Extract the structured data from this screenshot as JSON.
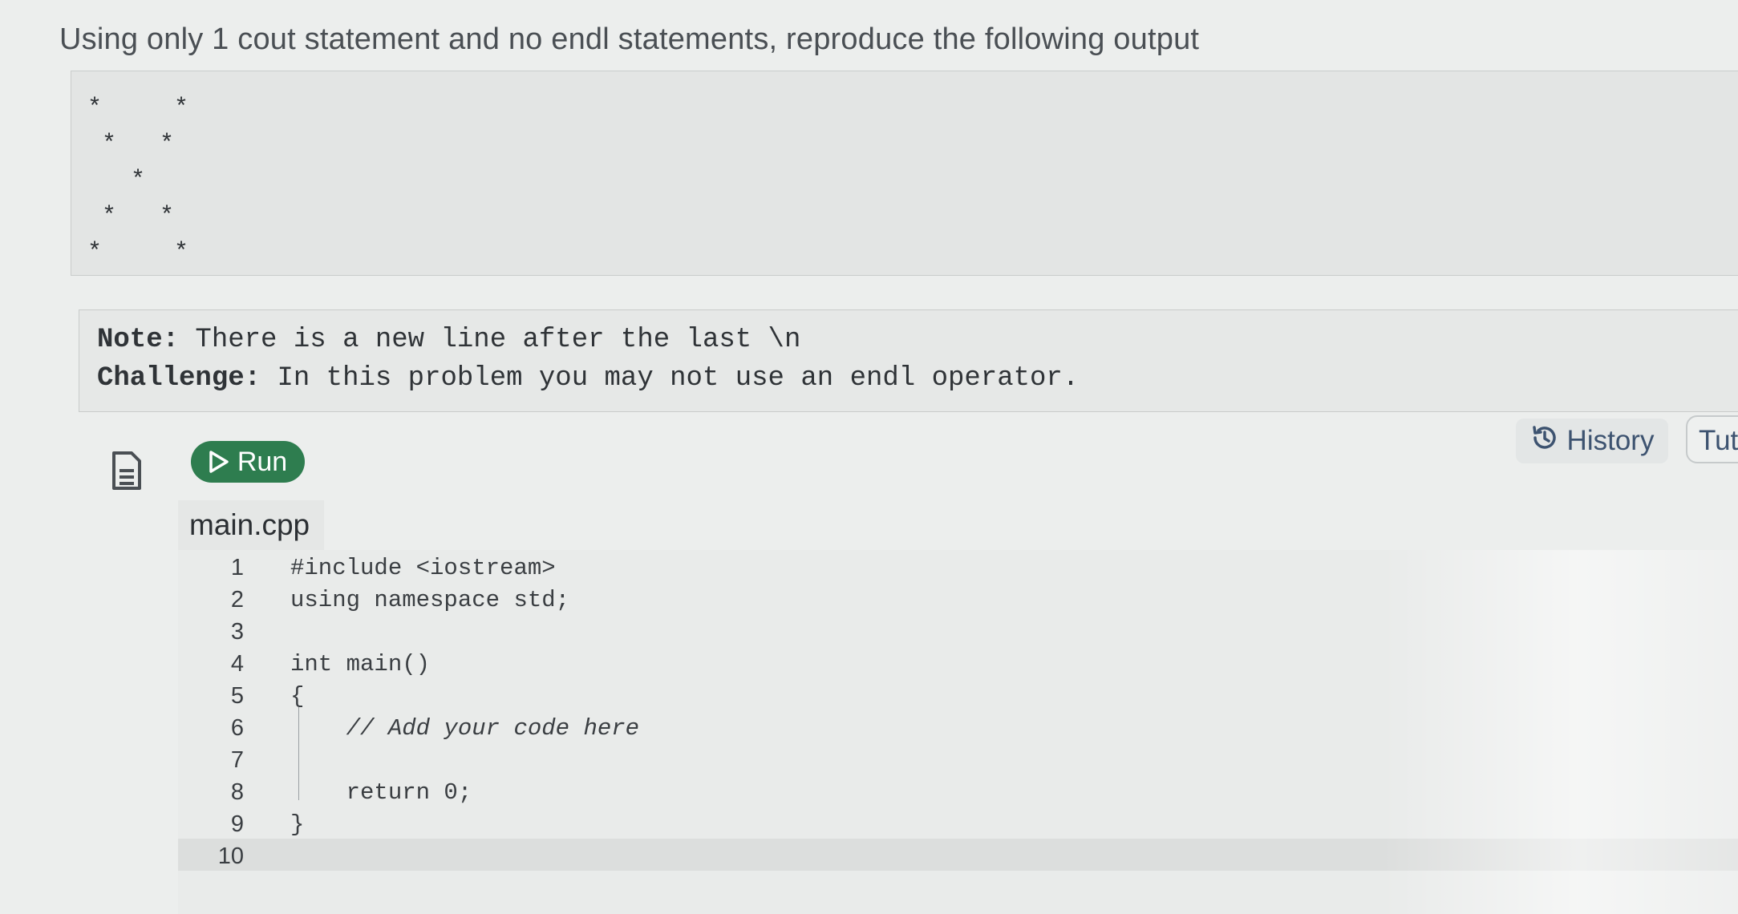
{
  "instruction": "Using only 1 cout statement and no endl statements, reproduce the following output",
  "expected_output": "*     *\n *   *\n   *\n *   *\n*     *",
  "note": {
    "line1": "Note: There is a new line after the last \\n",
    "challenge_label": "Challenge:",
    "challenge_text": " In this problem you may not use an endl operator."
  },
  "toolbar": {
    "run_label": "Run",
    "history_label": "History",
    "tutorial_label": "Tut"
  },
  "editor": {
    "file_name": "main.cpp",
    "lines": [
      {
        "num": "1",
        "code": "#include <iostream>"
      },
      {
        "num": "2",
        "code": "using namespace std;"
      },
      {
        "num": "3",
        "code": ""
      },
      {
        "num": "4",
        "code": "int main()"
      },
      {
        "num": "5",
        "code": "{"
      },
      {
        "num": "6",
        "code": "    // Add your code here"
      },
      {
        "num": "7",
        "code": ""
      },
      {
        "num": "8",
        "code": "    return 0;"
      },
      {
        "num": "9",
        "code": "}"
      },
      {
        "num": "10",
        "code": ""
      }
    ]
  },
  "icons": {
    "file": "file-document-icon",
    "run": "play-icon",
    "history": "history-clock-icon"
  },
  "colors": {
    "run_button": "#2e7d4f",
    "history_text": "#3d5370"
  }
}
